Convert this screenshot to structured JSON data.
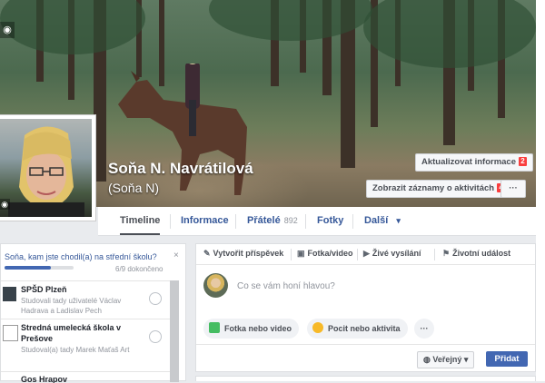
{
  "profile": {
    "name": "Soňa N. Navrátilová",
    "alternate_name": "(Soňa N)"
  },
  "cover_actions": {
    "update_info": "Aktualizovat informace",
    "update_info_badge": "2",
    "activity_log": "Zobrazit záznamy o aktivitách",
    "activity_log_badge": "4",
    "more": "···"
  },
  "nav": {
    "tabs": [
      {
        "label": "Timeline"
      },
      {
        "label": "Informace"
      },
      {
        "label": "Přátelé",
        "count": "892"
      },
      {
        "label": "Fotky"
      },
      {
        "label": "Další",
        "dropdown": "▾"
      }
    ]
  },
  "school_prompt": {
    "question": "Soňa, kam jste chodil(a) na střední školu?",
    "close": "×",
    "progress_text": "6/9 dokončeno",
    "progress_fraction": 0.667,
    "schools": [
      {
        "name": "SPŠD Plzeň",
        "sub": "Studovali tady uživatelé Václav Hadrava a Ladislav Pech"
      },
      {
        "name": "Stredná umelecká škola v Prešove",
        "sub": "Studoval(a) tady Marek Maťaš Art"
      },
      {
        "name": "Gos Hrapov",
        "sub": ""
      }
    ]
  },
  "composer": {
    "tabs": [
      "Vytvořit příspěvek",
      "Fotka/video",
      "Živé vysílání",
      "Životní událost"
    ],
    "placeholder": "Co se vám honí hlavou?",
    "actions": [
      "Fotka nebo video",
      "Pocit nebo aktivita",
      "···"
    ],
    "audience": "Veřejný",
    "post_button": "Přidat"
  },
  "colors": {
    "link_blue": "#365899",
    "primary_button": "#4267b2",
    "badge_red": "#fa3e3e"
  }
}
